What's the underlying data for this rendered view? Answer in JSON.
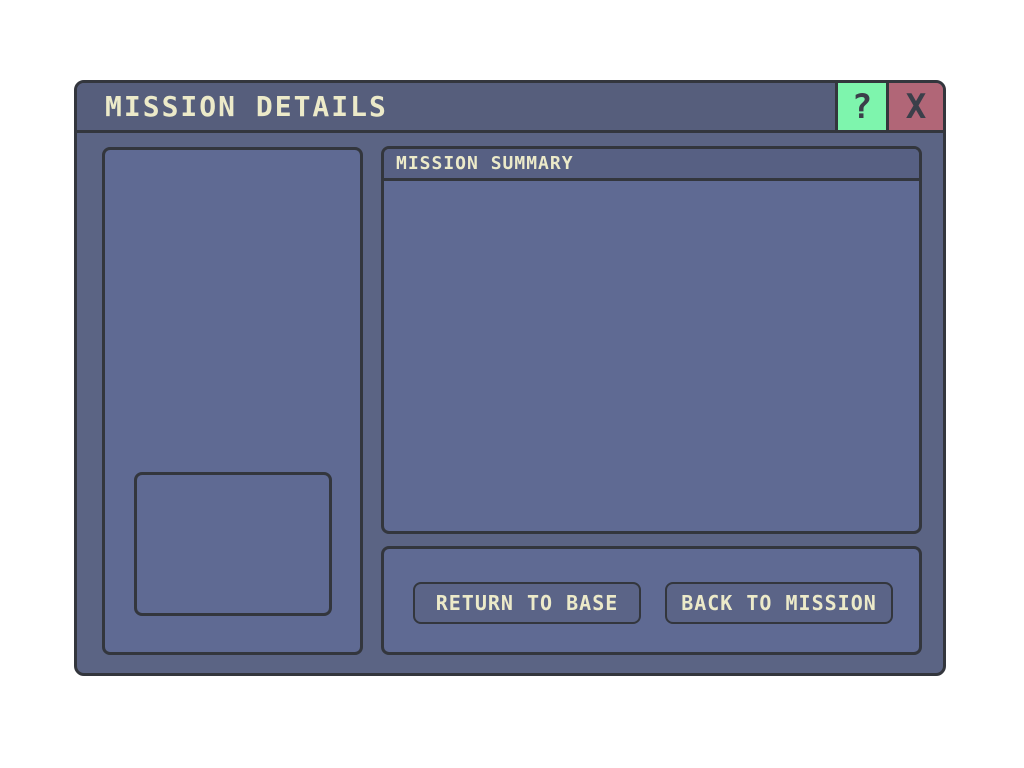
{
  "window": {
    "title": "MISSION DETAILS",
    "help_label": "?",
    "close_label": "X"
  },
  "summary": {
    "title": "MISSION SUMMARY",
    "body": ""
  },
  "actions": {
    "return_label": "RETURN TO BASE",
    "back_label": "BACK TO MISSION"
  },
  "colors": {
    "window_bg": "#5b6484",
    "panel_bg": "#5f6a93",
    "text": "#eceac9",
    "border": "#33363d",
    "help_bg": "#7ef5ad",
    "close_bg": "#b16677"
  }
}
